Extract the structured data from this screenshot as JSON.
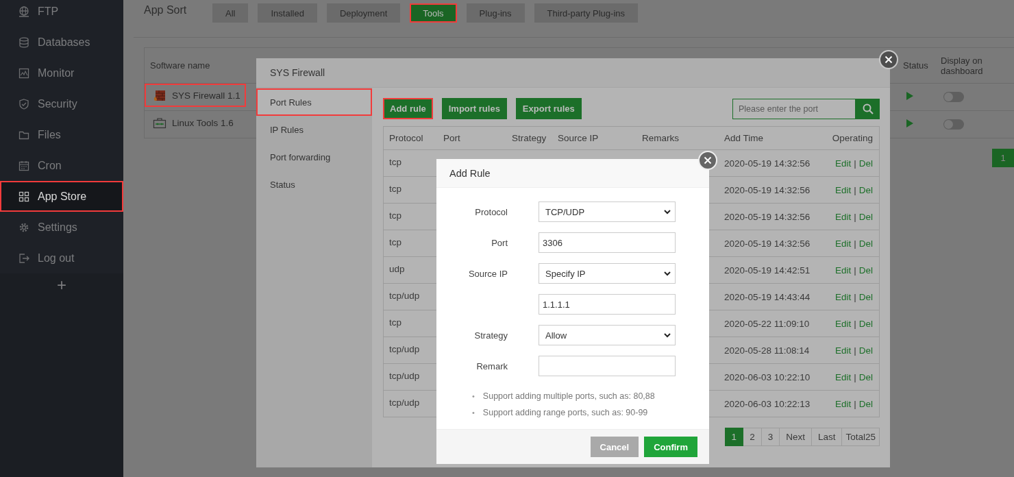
{
  "sidebar": {
    "items": [
      {
        "label": "FTP",
        "selected": false,
        "highlighted": false
      },
      {
        "label": "Databases",
        "selected": false,
        "highlighted": false
      },
      {
        "label": "Monitor",
        "selected": false,
        "highlighted": false
      },
      {
        "label": "Security",
        "selected": false,
        "highlighted": false
      },
      {
        "label": "Files",
        "selected": false,
        "highlighted": false
      },
      {
        "label": "Cron",
        "selected": false,
        "highlighted": false
      },
      {
        "label": "App Store",
        "selected": true,
        "highlighted": true
      },
      {
        "label": "Settings",
        "selected": false,
        "highlighted": false
      },
      {
        "label": "Log out",
        "selected": false,
        "highlighted": false
      }
    ],
    "add_label": "+"
  },
  "app_sort": {
    "label": "App Sort",
    "tabs": [
      {
        "label": "All",
        "selected": false,
        "highlighted": false
      },
      {
        "label": "Installed",
        "selected": false,
        "highlighted": false
      },
      {
        "label": "Deployment",
        "selected": false,
        "highlighted": false
      },
      {
        "label": "Tools",
        "selected": true,
        "highlighted": true
      },
      {
        "label": "Plug-ins",
        "selected": false,
        "highlighted": false
      },
      {
        "label": "Third-party Plug-ins",
        "selected": false,
        "highlighted": false
      }
    ]
  },
  "software_table": {
    "columns": [
      "Software name",
      "Status",
      "Display on dashboard"
    ],
    "rows": [
      {
        "name": "SYS Firewall 1.1",
        "highlighted": true,
        "running": true,
        "display_on_dashboard": false
      },
      {
        "name": "Linux Tools 1.6",
        "highlighted": false,
        "running": true,
        "display_on_dashboard": false
      }
    ],
    "pagination": [
      {
        "label": "1",
        "selected": true
      }
    ]
  },
  "firewall_dialog": {
    "title": "SYS Firewall",
    "tabs": [
      {
        "label": "Port Rules",
        "selected": true,
        "highlighted": true
      },
      {
        "label": "IP Rules",
        "selected": false,
        "highlighted": false
      },
      {
        "label": "Port forwarding",
        "selected": false,
        "highlighted": false
      },
      {
        "label": "Status",
        "selected": false,
        "highlighted": false
      }
    ],
    "toolbar": [
      {
        "label": "Add rule",
        "highlighted": true
      },
      {
        "label": "Import rules",
        "highlighted": false
      },
      {
        "label": "Export rules",
        "highlighted": false
      }
    ],
    "search": {
      "placeholder": "Please enter the port"
    },
    "table": {
      "columns": [
        "Protocol",
        "Port",
        "Strategy",
        "Source IP",
        "Remarks",
        "Add Time",
        "Operating"
      ],
      "action_separator": "|",
      "rows": [
        {
          "protocol": "tcp",
          "add_time": "2020-05-19 14:32:56",
          "actions": [
            "Edit",
            "Del"
          ]
        },
        {
          "protocol": "tcp",
          "add_time": "2020-05-19 14:32:56",
          "actions": [
            "Edit",
            "Del"
          ]
        },
        {
          "protocol": "tcp",
          "add_time": "2020-05-19 14:32:56",
          "actions": [
            "Edit",
            "Del"
          ]
        },
        {
          "protocol": "tcp",
          "add_time": "2020-05-19 14:32:56",
          "actions": [
            "Edit",
            "Del"
          ]
        },
        {
          "protocol": "udp",
          "add_time": "2020-05-19 14:42:51",
          "actions": [
            "Edit",
            "Del"
          ]
        },
        {
          "protocol": "tcp/udp",
          "add_time": "2020-05-19 14:43:44",
          "actions": [
            "Edit",
            "Del"
          ]
        },
        {
          "protocol": "tcp",
          "add_time": "2020-05-22 11:09:10",
          "actions": [
            "Edit",
            "Del"
          ]
        },
        {
          "protocol": "tcp/udp",
          "add_time": "2020-05-28 11:08:14",
          "actions": [
            "Edit",
            "Del"
          ]
        },
        {
          "protocol": "tcp/udp",
          "add_time": "2020-06-03 10:22:10",
          "actions": [
            "Edit",
            "Del"
          ]
        },
        {
          "protocol": "tcp/udp",
          "add_time": "2020-06-03 10:22:13",
          "actions": [
            "Edit",
            "Del"
          ]
        }
      ]
    },
    "pagination": [
      {
        "label": "1",
        "kind": "page",
        "selected": true
      },
      {
        "label": "2",
        "kind": "page",
        "selected": false
      },
      {
        "label": "3",
        "kind": "page",
        "selected": false
      },
      {
        "label": "Next",
        "kind": "page",
        "selected": false
      },
      {
        "label": "Last",
        "kind": "page",
        "selected": false
      },
      {
        "label": "Total25",
        "kind": "info"
      }
    ]
  },
  "add_rule_dialog": {
    "title": "Add Rule",
    "fields": [
      {
        "label": "Protocol",
        "kind": "select",
        "value": "TCP/UDP"
      },
      {
        "label": "Port",
        "kind": "input",
        "value": "3306"
      },
      {
        "label": "Source IP",
        "kind": "select",
        "value": "Specify IP"
      },
      {
        "kind": "input",
        "value": "1.1.1.1"
      },
      {
        "label": "Strategy",
        "kind": "select",
        "value": "Allow"
      },
      {
        "label": "Remark",
        "kind": "input"
      }
    ],
    "notes": [
      {
        "bullet": "•",
        "text": "Support adding multiple ports, such as: 80,88"
      },
      {
        "bullet": "•",
        "text": "Support adding range ports, such as: 90-99"
      }
    ],
    "buttons": [
      {
        "label": "Cancel",
        "disabled": true
      },
      {
        "label": "Confirm",
        "disabled": false
      }
    ]
  }
}
